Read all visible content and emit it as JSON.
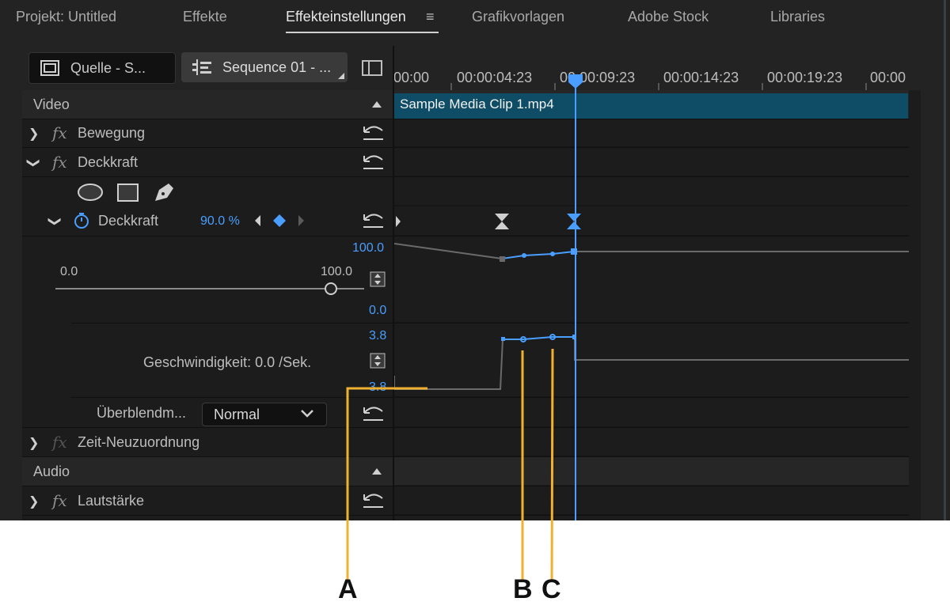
{
  "tabs": [
    {
      "label": "Projekt: Untitled"
    },
    {
      "label": "Effekte"
    },
    {
      "label": "Effekteinstellungen"
    },
    {
      "label": "Grafikvorlagen"
    },
    {
      "label": "Adobe Stock"
    },
    {
      "label": "Libraries"
    }
  ],
  "tab_menu_icon": "≡",
  "source_button": {
    "label": "Quelle - S..."
  },
  "sequence_button": {
    "label": "Sequence 01 - ..."
  },
  "ruler": {
    "times": [
      "00:00",
      "00:00:04:23",
      "00:00:09:23",
      "00:00:14:23",
      "00:00:19:23",
      "00:00"
    ]
  },
  "clip": {
    "name": "Sample Media Clip 1.mp4"
  },
  "sections": {
    "video": "Video",
    "audio": "Audio"
  },
  "effects": {
    "motion": "Bewegung",
    "opacity": "Deckkraft",
    "time_remap": "Zeit-Neuzuordnung",
    "volume": "Lautstärke"
  },
  "opacity_param": {
    "label": "Deckkraft",
    "value": "90.0 %",
    "slider_min": "0.0",
    "slider_max": "100.0",
    "slider_level": 1.0,
    "graph_top": "100.0",
    "graph_bottom": "0.0"
  },
  "velocity": {
    "label": "Geschwindigkeit: 0.0 /Sek.",
    "graph_top": "3.8",
    "graph_bottom": "3.8"
  },
  "blend_mode": {
    "label": "Überblendm...",
    "selected": "Normal"
  },
  "callouts": [
    "A",
    "B",
    "C"
  ],
  "colors": {
    "accent": "#4a9eff",
    "clip": "#0f4c66",
    "callout_line": "#f0b030"
  },
  "icons": [
    "stopwatch-icon",
    "keyframe-diamond-icon",
    "reset-icon",
    "ellipse-mask-icon",
    "rectangle-mask-icon",
    "pen-mask-icon",
    "playhead-icon"
  ]
}
